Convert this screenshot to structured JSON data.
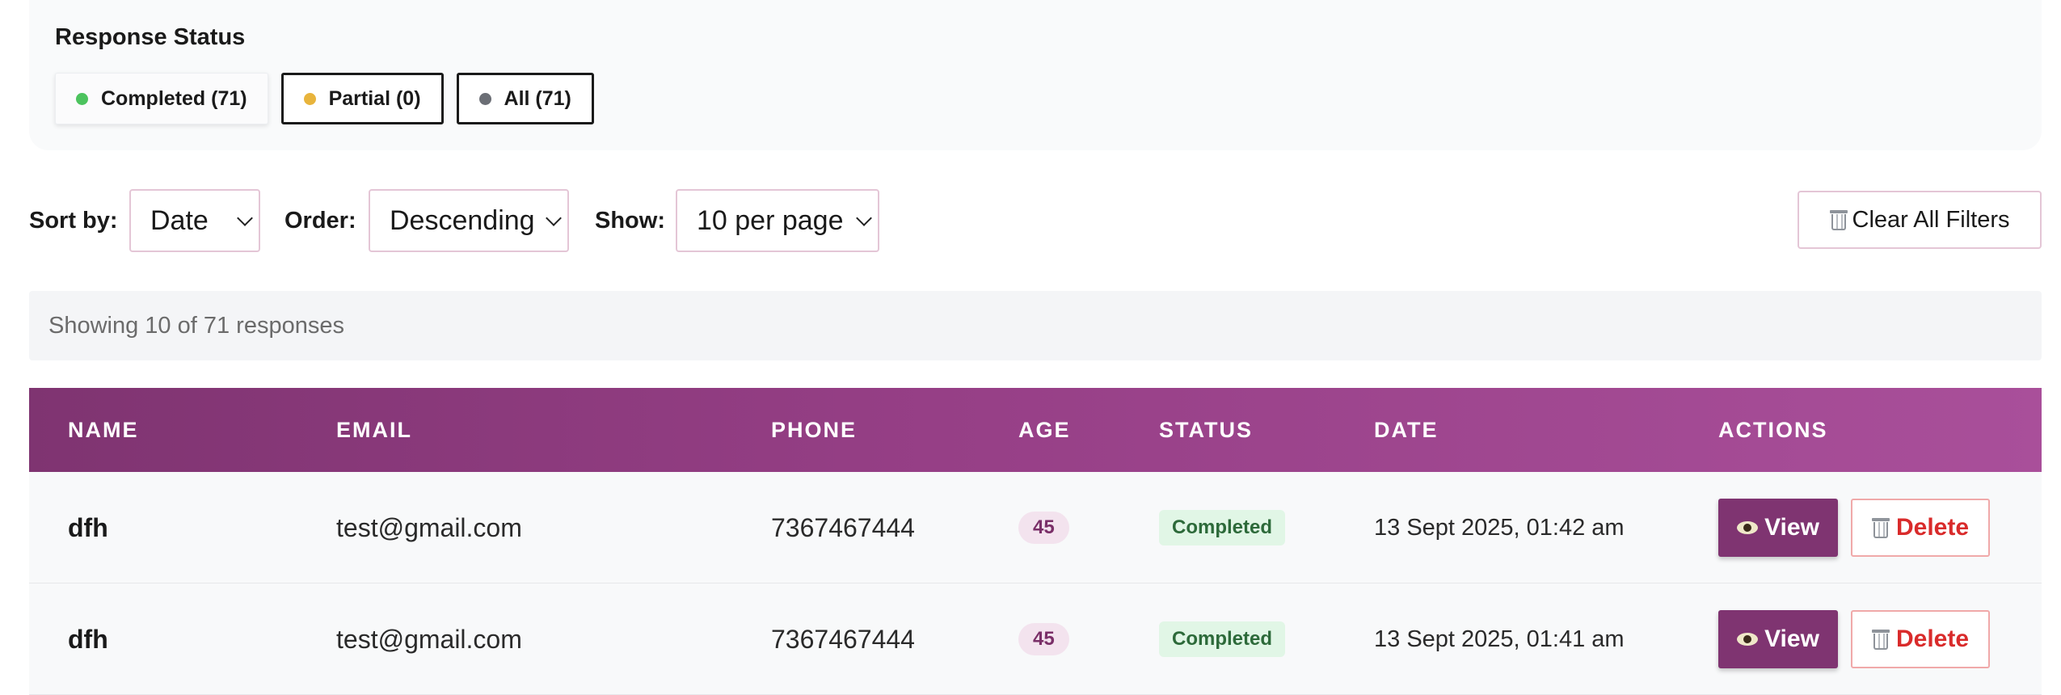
{
  "status_panel": {
    "title": "Response Status",
    "filters": [
      {
        "label": "Completed (71)",
        "color": "#4cc35e",
        "active": true
      },
      {
        "label": "Partial (0)",
        "color": "#e8b43c",
        "active": false
      },
      {
        "label": "All (71)",
        "color": "#6b6e75",
        "active": false
      }
    ]
  },
  "controls": {
    "sort_label": "Sort by:",
    "sort_value": "Date",
    "order_label": "Order:",
    "order_value": "Descending",
    "show_label": "Show:",
    "show_value": "10 per page",
    "clear_label": "Clear All Filters"
  },
  "showing_text": "Showing 10 of 71 responses",
  "table": {
    "headers": [
      "NAME",
      "EMAIL",
      "PHONE",
      "AGE",
      "STATUS",
      "DATE",
      "ACTIONS"
    ],
    "rows": [
      {
        "name": "dfh",
        "email": "test@gmail.com",
        "phone": "7367467444",
        "age": "45",
        "status": "Completed",
        "date": "13 Sept 2025, 01:42 am"
      },
      {
        "name": "dfh",
        "email": "test@gmail.com",
        "phone": "7367467444",
        "age": "45",
        "status": "Completed",
        "date": "13 Sept 2025, 01:41 am"
      }
    ],
    "view_label": "View",
    "delete_label": "Delete"
  },
  "colors": {
    "brand": "#7f3471",
    "completed": "#4cc35e",
    "partial": "#e8b43c",
    "all": "#6b6e75",
    "danger": "#d92b2b"
  }
}
